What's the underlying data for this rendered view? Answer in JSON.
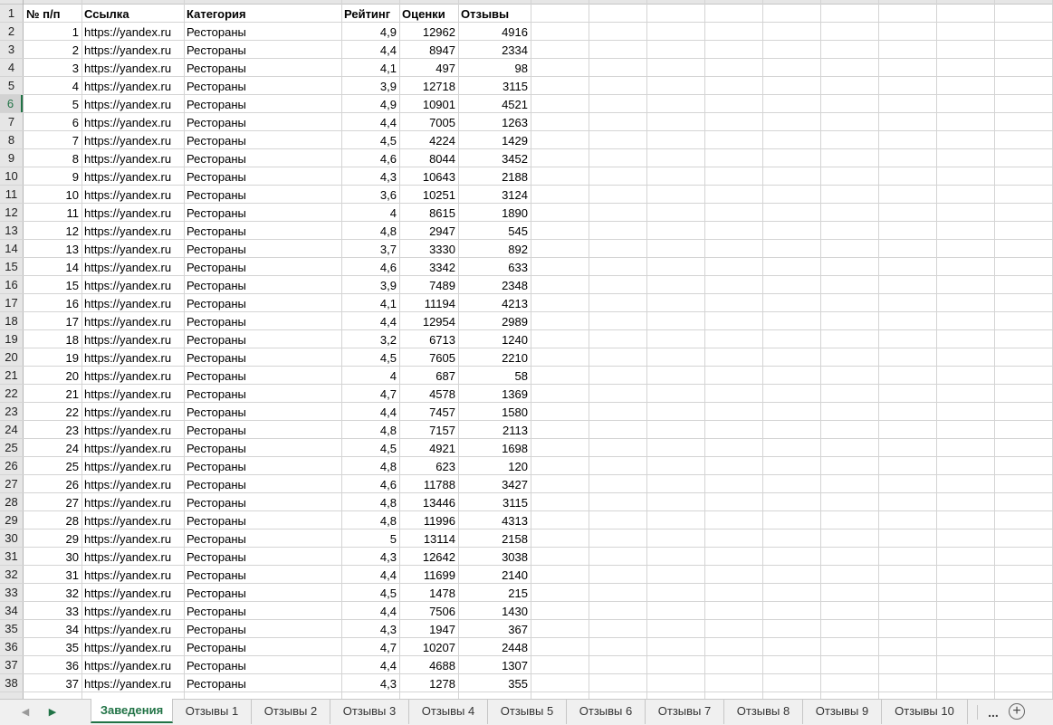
{
  "headers": [
    "№ п/п",
    "Ссылка",
    "Категория",
    "Рейтинг",
    "Оценки",
    "Отзывы"
  ],
  "first_row_number": 1,
  "active_row": 6,
  "rows": [
    [
      "1",
      "https://yandex.ru",
      "Рестораны",
      "4,9",
      "12962",
      "4916"
    ],
    [
      "2",
      "https://yandex.ru",
      "Рестораны",
      "4,4",
      "8947",
      "2334"
    ],
    [
      "3",
      "https://yandex.ru",
      "Рестораны",
      "4,1",
      "497",
      "98"
    ],
    [
      "4",
      "https://yandex.ru",
      "Рестораны",
      "3,9",
      "12718",
      "3115"
    ],
    [
      "5",
      "https://yandex.ru",
      "Рестораны",
      "4,9",
      "10901",
      "4521"
    ],
    [
      "6",
      "https://yandex.ru",
      "Рестораны",
      "4,4",
      "7005",
      "1263"
    ],
    [
      "7",
      "https://yandex.ru",
      "Рестораны",
      "4,5",
      "4224",
      "1429"
    ],
    [
      "8",
      "https://yandex.ru",
      "Рестораны",
      "4,6",
      "8044",
      "3452"
    ],
    [
      "9",
      "https://yandex.ru",
      "Рестораны",
      "4,3",
      "10643",
      "2188"
    ],
    [
      "10",
      "https://yandex.ru",
      "Рестораны",
      "3,6",
      "10251",
      "3124"
    ],
    [
      "11",
      "https://yandex.ru",
      "Рестораны",
      "4",
      "8615",
      "1890"
    ],
    [
      "12",
      "https://yandex.ru",
      "Рестораны",
      "4,8",
      "2947",
      "545"
    ],
    [
      "13",
      "https://yandex.ru",
      "Рестораны",
      "3,7",
      "3330",
      "892"
    ],
    [
      "14",
      "https://yandex.ru",
      "Рестораны",
      "4,6",
      "3342",
      "633"
    ],
    [
      "15",
      "https://yandex.ru",
      "Рестораны",
      "3,9",
      "7489",
      "2348"
    ],
    [
      "16",
      "https://yandex.ru",
      "Рестораны",
      "4,1",
      "11194",
      "4213"
    ],
    [
      "17",
      "https://yandex.ru",
      "Рестораны",
      "4,4",
      "12954",
      "2989"
    ],
    [
      "18",
      "https://yandex.ru",
      "Рестораны",
      "3,2",
      "6713",
      "1240"
    ],
    [
      "19",
      "https://yandex.ru",
      "Рестораны",
      "4,5",
      "7605",
      "2210"
    ],
    [
      "20",
      "https://yandex.ru",
      "Рестораны",
      "4",
      "687",
      "58"
    ],
    [
      "21",
      "https://yandex.ru",
      "Рестораны",
      "4,7",
      "4578",
      "1369"
    ],
    [
      "22",
      "https://yandex.ru",
      "Рестораны",
      "4,4",
      "7457",
      "1580"
    ],
    [
      "23",
      "https://yandex.ru",
      "Рестораны",
      "4,8",
      "7157",
      "2113"
    ],
    [
      "24",
      "https://yandex.ru",
      "Рестораны",
      "4,5",
      "4921",
      "1698"
    ],
    [
      "25",
      "https://yandex.ru",
      "Рестораны",
      "4,8",
      "623",
      "120"
    ],
    [
      "26",
      "https://yandex.ru",
      "Рестораны",
      "4,6",
      "11788",
      "3427"
    ],
    [
      "27",
      "https://yandex.ru",
      "Рестораны",
      "4,8",
      "13446",
      "3115"
    ],
    [
      "28",
      "https://yandex.ru",
      "Рестораны",
      "4,8",
      "11996",
      "4313"
    ],
    [
      "29",
      "https://yandex.ru",
      "Рестораны",
      "5",
      "13114",
      "2158"
    ],
    [
      "30",
      "https://yandex.ru",
      "Рестораны",
      "4,3",
      "12642",
      "3038"
    ],
    [
      "31",
      "https://yandex.ru",
      "Рестораны",
      "4,4",
      "11699",
      "2140"
    ],
    [
      "32",
      "https://yandex.ru",
      "Рестораны",
      "4,5",
      "1478",
      "215"
    ],
    [
      "33",
      "https://yandex.ru",
      "Рестораны",
      "4,4",
      "7506",
      "1430"
    ],
    [
      "34",
      "https://yandex.ru",
      "Рестораны",
      "4,3",
      "1947",
      "367"
    ],
    [
      "35",
      "https://yandex.ru",
      "Рестораны",
      "4,7",
      "10207",
      "2448"
    ],
    [
      "36",
      "https://yandex.ru",
      "Рестораны",
      "4,4",
      "4688",
      "1307"
    ],
    [
      "37",
      "https://yandex.ru",
      "Рестораны",
      "4,3",
      "1278",
      "355"
    ]
  ],
  "sheet_tabs": {
    "prev_icon": "triangle-left-icon",
    "next_icon": "triangle-right-icon",
    "tabs": [
      "Заведения",
      "Отзывы 1",
      "Отзывы 2",
      "Отзывы 3",
      "Отзывы 4",
      "Отзывы 5",
      "Отзывы 6",
      "Отзывы 7",
      "Отзывы 8",
      "Отзывы 9",
      "Отзывы 10"
    ],
    "active_tab": "Заведения",
    "more_label": "...",
    "add_label": "+",
    "accent_color": "#217346"
  }
}
